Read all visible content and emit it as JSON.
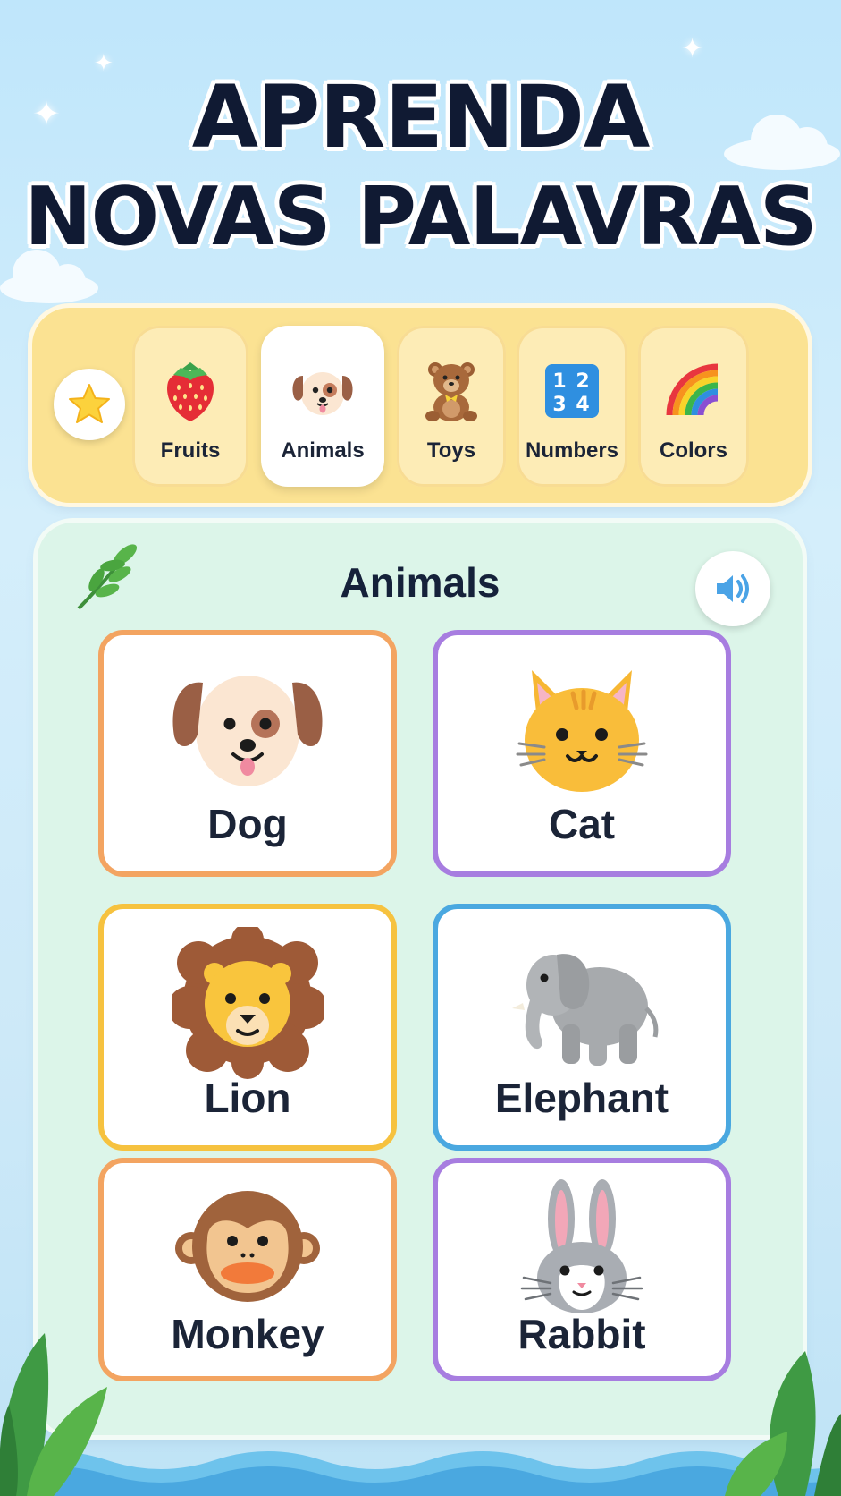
{
  "header": {
    "title_line1": "APRENDA",
    "title_line2": "NOVAS PALAVRAS"
  },
  "categories": {
    "star_icon": "star-icon",
    "tabs": [
      {
        "label": "Fruits",
        "icon": "strawberry-icon",
        "active": false
      },
      {
        "label": "Animals",
        "icon": "puppy-icon",
        "active": true
      },
      {
        "label": "Toys",
        "icon": "teddy-bear-icon",
        "active": false
      },
      {
        "label": "Numbers",
        "icon": "numbers-1234-icon",
        "active": false
      },
      {
        "label": "Colors",
        "icon": "rainbow-icon",
        "active": false
      }
    ]
  },
  "panel": {
    "title": "Animals",
    "leaf_icon": "leaf-icon",
    "speaker_icon": "speaker-icon",
    "cards": [
      {
        "word": "Dog",
        "icon": "dog-icon",
        "border_color": "#f3a461"
      },
      {
        "word": "Cat",
        "icon": "cat-icon",
        "border_color": "#a77de0"
      },
      {
        "word": "Lion",
        "icon": "lion-icon",
        "border_color": "#f6c23f"
      },
      {
        "word": "Elephant",
        "icon": "elephant-icon",
        "border_color": "#4aa8e0"
      },
      {
        "word": "Monkey",
        "icon": "monkey-icon",
        "border_color": "#f3a461"
      },
      {
        "word": "Rabbit",
        "icon": "rabbit-icon",
        "border_color": "#a77de0"
      }
    ]
  },
  "colors": {
    "title": "#101a33",
    "category_bar": "#fbe292",
    "panel": "#dcf5e9",
    "speaker": "#4aa3e6"
  }
}
